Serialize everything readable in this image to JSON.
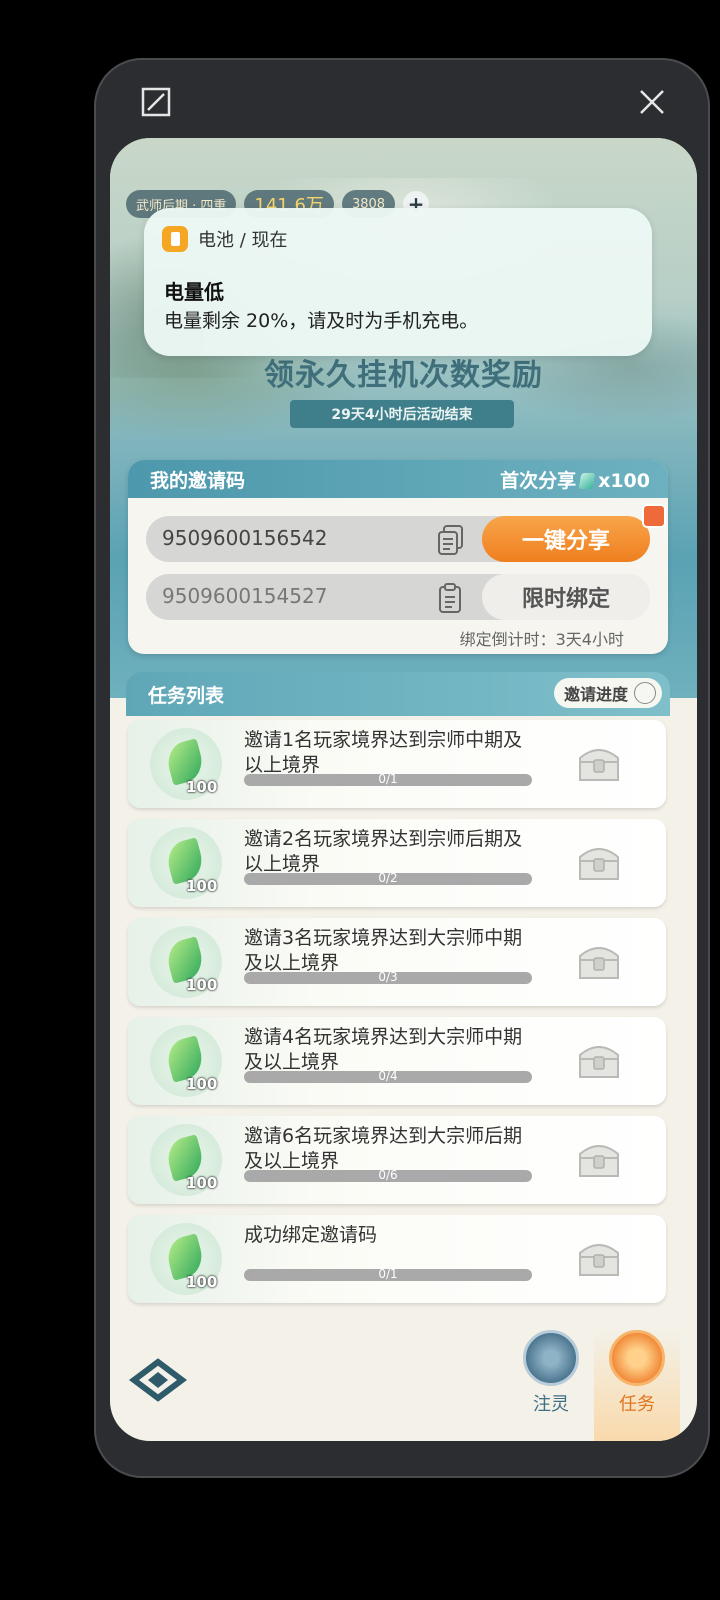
{
  "window": {
    "expand_icon": "expand-icon",
    "close_icon": "close-icon"
  },
  "player": {
    "realm": "武师后期 · 四重",
    "power": "141.6万",
    "coins": "3808",
    "plus": "+"
  },
  "notification": {
    "app": "电池 / 现在",
    "title": "电量低",
    "body": "电量剩余 20%，请及时为手机充电。"
  },
  "event": {
    "headline": "领永久挂机次数奖励",
    "countdown": "29天4小时后活动结束"
  },
  "invite": {
    "title": "我的邀请码",
    "first_share_label": "首次分享",
    "first_share_reward": "x100",
    "my_code": "9509600156542",
    "share_button": "一键分享",
    "bind_code": "9509600154527",
    "bind_button": "限时绑定",
    "bind_countdown": "绑定倒计时：3天4小时"
  },
  "tasks": {
    "title": "任务列表",
    "progress_button": "邀请进度",
    "items": [
      {
        "text": "邀请1名玩家境界达到宗师中期及以上境界",
        "reward": "100",
        "progress": "0/1",
        "fraction": 0
      },
      {
        "text": "邀请2名玩家境界达到宗师后期及以上境界",
        "reward": "100",
        "progress": "0/2",
        "fraction": 0
      },
      {
        "text": "邀请3名玩家境界达到大宗师中期及以上境界",
        "reward": "100",
        "progress": "0/3",
        "fraction": 0
      },
      {
        "text": "邀请4名玩家境界达到大宗师中期及以上境界",
        "reward": "100",
        "progress": "0/4",
        "fraction": 0
      },
      {
        "text": "邀请6名玩家境界达到大宗师后期及以上境界",
        "reward": "100",
        "progress": "0/6",
        "fraction": 0
      },
      {
        "text": "成功绑定邀请码",
        "reward": "100",
        "progress": "0/1",
        "fraction": 0
      }
    ]
  },
  "nav": {
    "item1": "注灵",
    "item2": "任务"
  }
}
